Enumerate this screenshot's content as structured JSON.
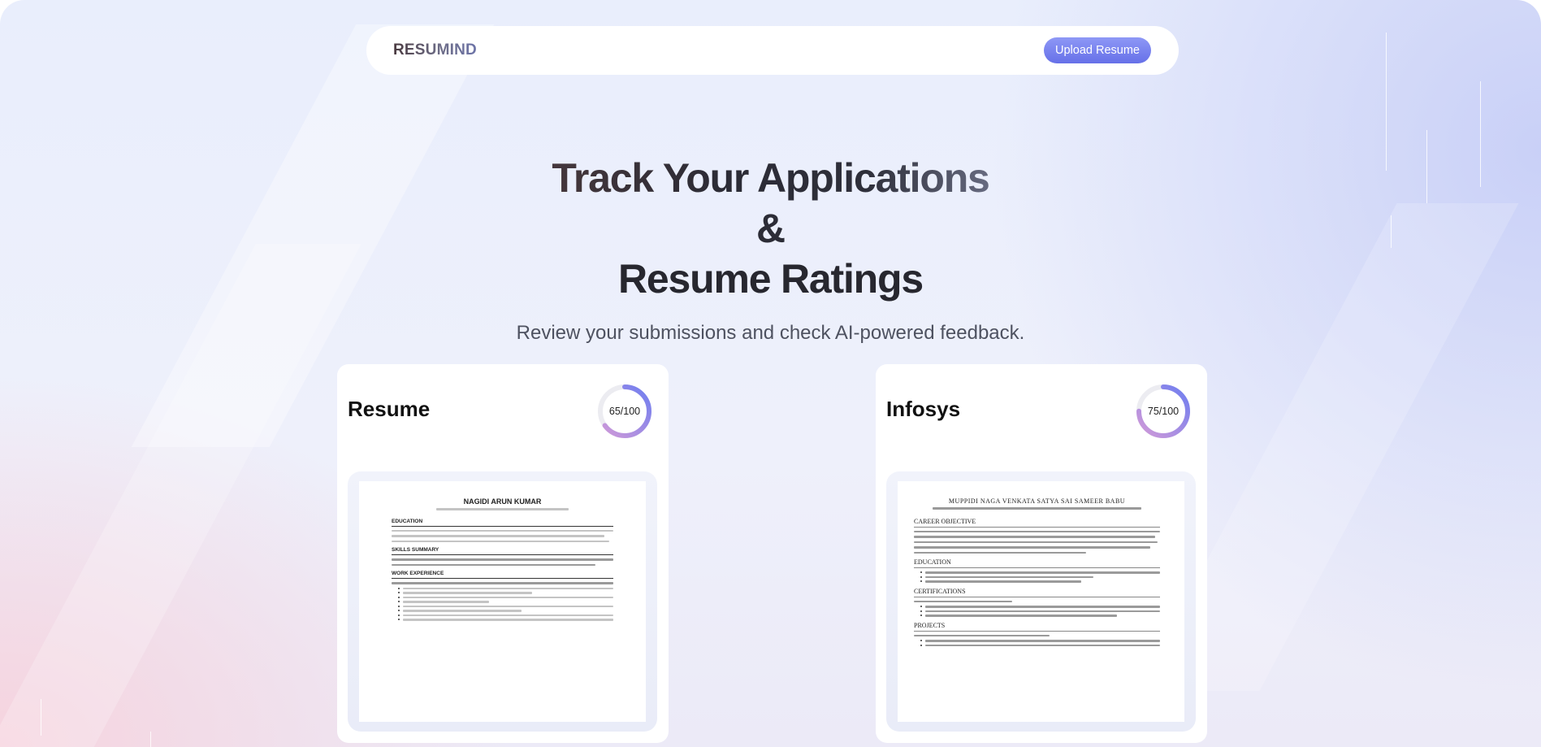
{
  "brand": {
    "logo_text": "RESUMIND"
  },
  "navbar": {
    "upload_label": "Upload Resume"
  },
  "hero": {
    "title_line1": "Track Your Applications &",
    "title_line2": "Resume Ratings",
    "subtitle": "Review your submissions and check AI-powered feedback."
  },
  "cards": [
    {
      "title": "Resume",
      "score_text": "65/100",
      "score": 65,
      "preview": {
        "name": "NAGIDI ARUN KUMAR",
        "sections": [
          "EDUCATION",
          "SKILLS SUMMARY",
          "WORK EXPERIENCE"
        ]
      }
    },
    {
      "title": "Infosys",
      "score_text": "75/100",
      "score": 75,
      "preview": {
        "name": "MUPPIDI NAGA VENKATA SATYA SAI SAMEER BABU",
        "sections": [
          "CAREER OBJECTIVE",
          "EDUCATION",
          "CERTIFICATIONS",
          "PROJECTS"
        ]
      }
    }
  ],
  "colors": {
    "accent": "#6670e8",
    "ring_start": "#c98fd6",
    "ring_end": "#6f7ef0",
    "ring_track": "#ececf1"
  }
}
